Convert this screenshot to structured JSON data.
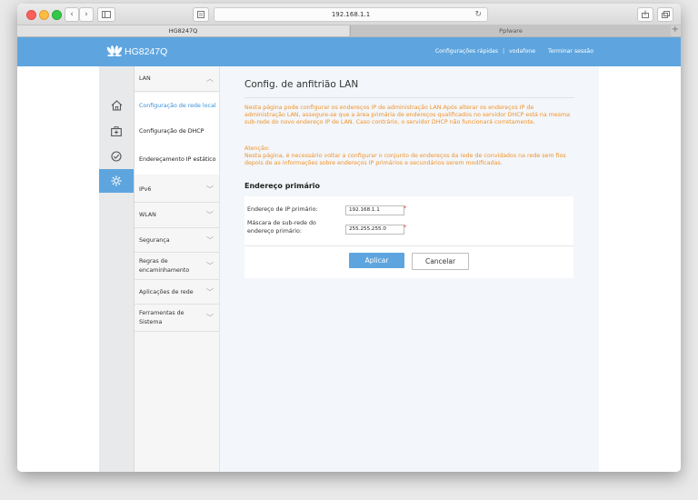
{
  "browser": {
    "url": "192.168.1.1",
    "tabs": [
      {
        "label": "HG8247Q"
      },
      {
        "label": "Pplware"
      }
    ]
  },
  "header": {
    "brand": "HG8247Q",
    "quick_settings": "Configurações rápidas",
    "user": "vodafone",
    "logout": "Terminar sessão",
    "accent": "#5ea5df"
  },
  "nav": {
    "sections": [
      {
        "label": "LAN"
      },
      {
        "label": "IPv6"
      },
      {
        "label": "WLAN"
      },
      {
        "label": "Segurança"
      },
      {
        "label": "Regras de encaminhamento"
      },
      {
        "label": "Aplicações de rede"
      },
      {
        "label": "Ferramentas de Sistema"
      }
    ],
    "lan_items": [
      {
        "label": "Configuração de rede local"
      },
      {
        "label": "Configuração de DHCP"
      },
      {
        "label": "Endereçamento IP estático"
      }
    ]
  },
  "main": {
    "title": "Config. de anfitrião LAN",
    "description": "Nesta página pode configurar os endereços IP de administração LAN.Após alterar os endereços IP de administração LAN, assegure-se que a área primária de endereços qualificados no servidor DHCP está na mesma sub-rede do novo endereço IP de LAN. Caso contrário, o servidor DHCP não funcionará corretamente.",
    "attention_title": "Atenção:",
    "attention_text": "Nesta página, é necessário voltar a configurar o conjunto de endereços da rede de convidados na rede sem fios depois de as informações sobre endereços IP primários e secundários serem modificadas.",
    "section_title": "Endereço primário",
    "fields": [
      {
        "label": "Endereço de IP primário:",
        "value": "192.168.1.1"
      },
      {
        "label": "Máscara de sub-rede do endereço primário:",
        "value": "255.255.255.0"
      }
    ],
    "required_mark": "*",
    "apply": "Aplicar",
    "cancel": "Cancelar"
  }
}
